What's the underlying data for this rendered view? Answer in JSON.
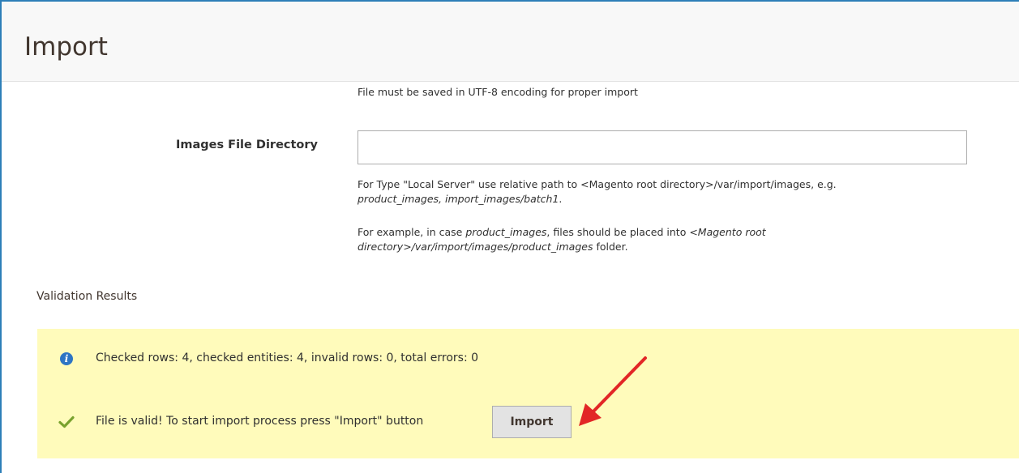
{
  "header": {
    "title": "Import"
  },
  "form": {
    "encoding_note": "File must be saved in UTF-8 encoding for proper import",
    "images_dir": {
      "label": "Images File Directory",
      "value": "",
      "help1_a": "For Type \"Local Server\" use relative path to <Magento root directory>/var/import/images, e.g.",
      "help1_b": "product_images, import_images/batch1",
      "help1_c": ".",
      "help2_a": "For example, in case ",
      "help2_b": "product_images",
      "help2_c": ", files should be placed into ",
      "help2_d": "<Magento root directory>/var/import/images/product_images",
      "help2_e": " folder."
    }
  },
  "validation": {
    "title": "Validation Results",
    "info_message": "Checked rows: 4, checked entities: 4, invalid rows: 0, total errors: 0",
    "success_message": "File is valid! To start import process press \"Import\" button",
    "import_button_label": "Import"
  },
  "colors": {
    "frame_border": "#2d7fb8",
    "message_bg": "#fffbbb",
    "info_icon": "#2e75c4",
    "check_icon": "#79a22e",
    "annotation_arrow": "#e22626"
  },
  "icons": {
    "info": "info-icon",
    "success": "check-icon",
    "annotation": "red-arrow-icon"
  }
}
